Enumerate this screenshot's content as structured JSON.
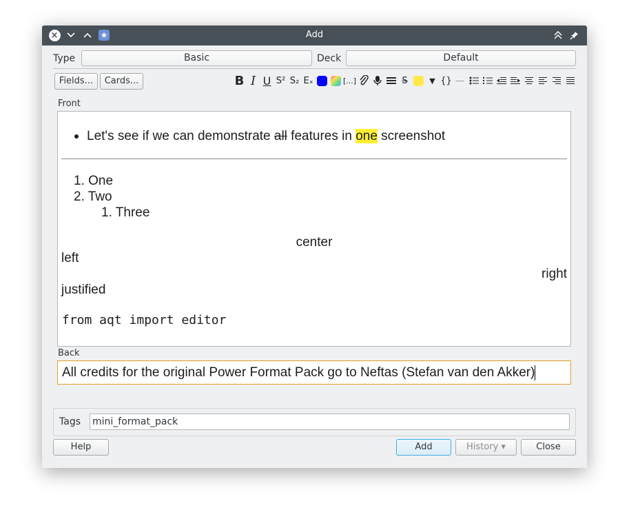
{
  "window": {
    "title": "Add"
  },
  "type_row": {
    "type_label": "Type",
    "type_value": "Basic",
    "deck_label": "Deck",
    "deck_value": "Default"
  },
  "buttons": {
    "fields": "Fields...",
    "cards": "Cards...",
    "help": "Help",
    "add": "Add",
    "history": "History ▾",
    "close": "Close"
  },
  "toolbar": {
    "bold": "B",
    "italic": "I",
    "underline": "U",
    "superscript": "S²",
    "subscript": "S₂",
    "clear_format": "Eₓ",
    "cloze": "[...]",
    "strike": "S",
    "code": "{}",
    "hr": "—",
    "dropdown": "▼",
    "colors": {
      "text_color": "#0000ff",
      "highlight": "#ffe94a"
    }
  },
  "fields": {
    "front_label": "Front",
    "front": {
      "bullet_text_1": "Let's see if we can demonstrate ",
      "bullet_strike": "all",
      "bullet_text_2": " features in ",
      "bullet_highlight": "one",
      "bullet_text_3": " screenshot",
      "list": [
        "1. One",
        "2. Two"
      ],
      "sublist": [
        "1. Three"
      ],
      "center": "center",
      "left": "left",
      "right": "right",
      "justified": "justified",
      "code": "from aqt import editor"
    },
    "back_label": "Back",
    "back": "All credits for the original Power Format Pack go to Neftas (Stefan van den Akker)"
  },
  "tags": {
    "label": "Tags",
    "value": "mini_format_pack"
  }
}
